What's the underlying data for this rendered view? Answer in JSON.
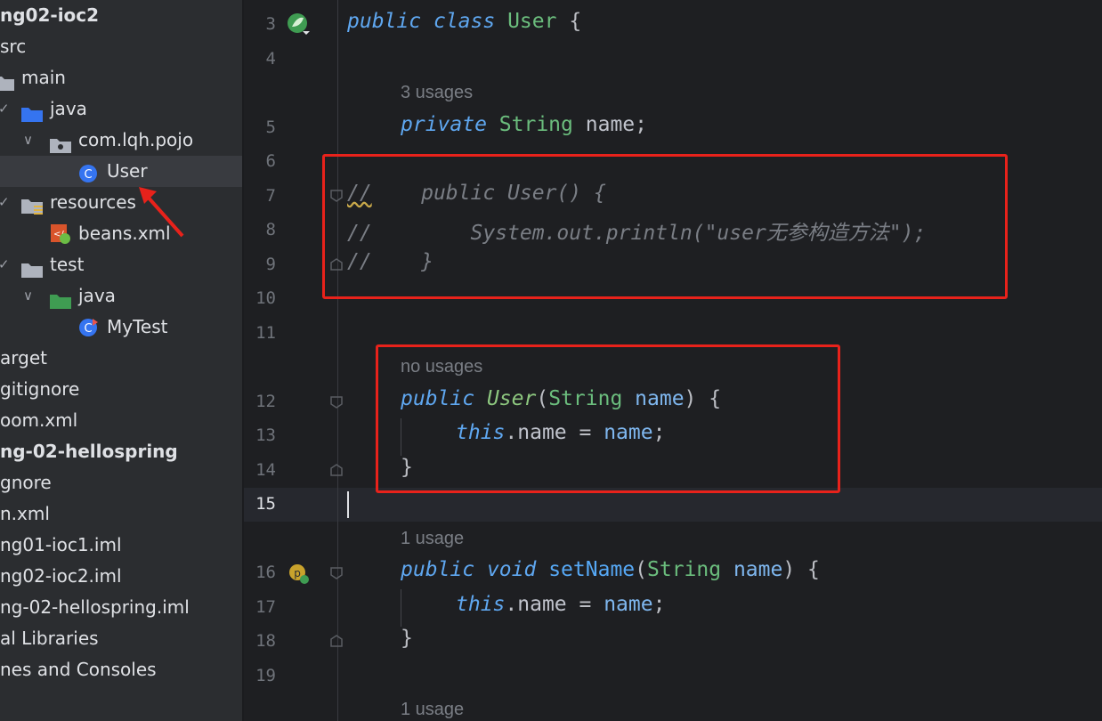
{
  "project_tree": {
    "items": [
      {
        "label": "ng02-ioc2",
        "icon": "",
        "bold": true
      },
      {
        "label": "src",
        "icon": ""
      },
      {
        "label": "main",
        "icon": "folder-icon"
      },
      {
        "label": "java",
        "icon": "source-folder-icon",
        "chevron": "✓"
      },
      {
        "label": "com.lqh.pojo",
        "icon": "package-icon",
        "chevron": "∨"
      },
      {
        "label": "User",
        "icon": "class-icon",
        "selected": true
      },
      {
        "label": "resources",
        "icon": "resources-folder-icon",
        "chevron": "✓"
      },
      {
        "label": "beans.xml",
        "icon": "xml-spring-icon"
      },
      {
        "label": "test",
        "icon": "folder-icon",
        "chevron": "✓"
      },
      {
        "label": "java",
        "icon": "test-folder-icon",
        "chevron": "∨"
      },
      {
        "label": "MyTest",
        "icon": "test-class-icon"
      },
      {
        "label": "arget",
        "icon": ""
      },
      {
        "label": "gitignore",
        "icon": ""
      },
      {
        "label": "oom.xml",
        "icon": ""
      },
      {
        "label": "ng-02-hellospring",
        "icon": "",
        "bold": true
      },
      {
        "label": "gnore",
        "icon": ""
      },
      {
        "label": "n.xml",
        "icon": ""
      },
      {
        "label": "ng01-ioc1.iml",
        "icon": ""
      },
      {
        "label": "ng02-ioc2.iml",
        "icon": ""
      },
      {
        "label": "ng-02-hellospring.iml",
        "icon": ""
      },
      {
        "label": "al Libraries",
        "icon": ""
      },
      {
        "label": "nes and Consoles",
        "icon": ""
      }
    ]
  },
  "editor": {
    "lines": {
      "l3": {
        "num": "3",
        "kw1": "public",
        "kw2": "class",
        "name": "User",
        "brace": "{"
      },
      "l4": {
        "num": "4"
      },
      "hint5": "3 usages",
      "l5": {
        "num": "5",
        "kw": "private",
        "type": "String",
        "field": "name",
        "semi": ";"
      },
      "l6": {
        "num": "6"
      },
      "l7": {
        "num": "7",
        "comment": "//",
        "rest": "    public User() {"
      },
      "l8": {
        "num": "8",
        "text": "//        System.out.println(\"user无参构造方法\");"
      },
      "l9": {
        "num": "9",
        "text": "//    }"
      },
      "l10": {
        "num": "10"
      },
      "l11": {
        "num": "11"
      },
      "hint12": "no usages",
      "l12": {
        "num": "12",
        "kw": "public",
        "ctor": "User",
        "open": "(",
        "type": "String",
        "param": "name",
        "close": ") {"
      },
      "l13": {
        "num": "13",
        "kw": "this",
        "dot": ".",
        "field": "name",
        "eq": " = ",
        "param": "name",
        "semi": ";"
      },
      "l14": {
        "num": "14",
        "brace": "}"
      },
      "l15": {
        "num": "15"
      },
      "hint16": "1 usage",
      "l16": {
        "num": "16",
        "kw1": "public",
        "kw2": "void",
        "fn": "setName",
        "open": "(",
        "type": "String",
        "param": "name",
        "close": ") {"
      },
      "l17": {
        "num": "17",
        "kw": "this",
        "dot": ".",
        "field": "name",
        "eq": " = ",
        "param": "name",
        "semi": ";"
      },
      "l18": {
        "num": "18",
        "brace": "}"
      },
      "l19": {
        "num": "19"
      },
      "hint20": "1 usage"
    }
  },
  "colors": {
    "annotation_red": "#e8221b",
    "keyword": "#5fa7f0",
    "type": "#6bbd7d"
  }
}
